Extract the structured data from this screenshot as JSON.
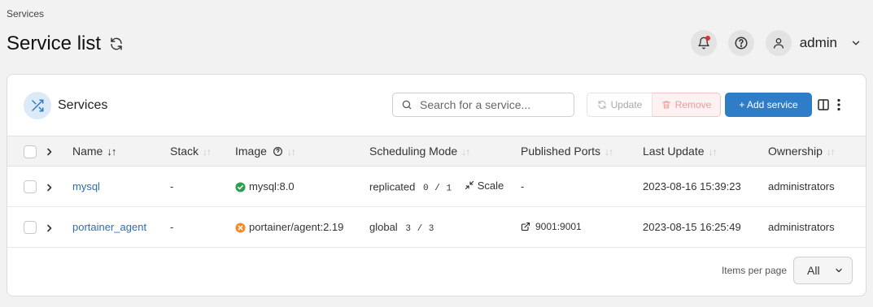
{
  "breadcrumb": "Services",
  "page_title": "Service list",
  "user": {
    "name": "admin"
  },
  "card": {
    "title": "Services",
    "search_placeholder": "Search for a service...",
    "update_label": "Update",
    "remove_label": "Remove",
    "add_label": "+ Add service"
  },
  "columns": {
    "name": "Name",
    "stack": "Stack",
    "image": "Image",
    "scheduling": "Scheduling Mode",
    "ports": "Published Ports",
    "last_update": "Last Update",
    "ownership": "Ownership"
  },
  "rows": [
    {
      "name": "mysql",
      "stack": "-",
      "image": "mysql:8.0",
      "image_status": "success",
      "mode": "replicated",
      "running": "0",
      "sep": "/",
      "desired": "1",
      "scale_label": "Scale",
      "ports": "-",
      "last_update": "2023-08-16 15:39:23",
      "ownership": "administrators"
    },
    {
      "name": "portainer_agent",
      "stack": "-",
      "image": "portainer/agent:2.19",
      "image_status": "error",
      "mode": "global",
      "running": "3",
      "sep": "/",
      "desired": "3",
      "ports": "9001:9001",
      "last_update": "2023-08-15 16:25:49",
      "ownership": "administrators"
    }
  ],
  "pagination": {
    "label": "Items per page",
    "value": "All"
  },
  "colors": {
    "primary": "#2f7dc6",
    "link": "#2f6cb3",
    "success": "#2e9e4f",
    "warning": "#f08c2e",
    "danger": "#e03131"
  }
}
